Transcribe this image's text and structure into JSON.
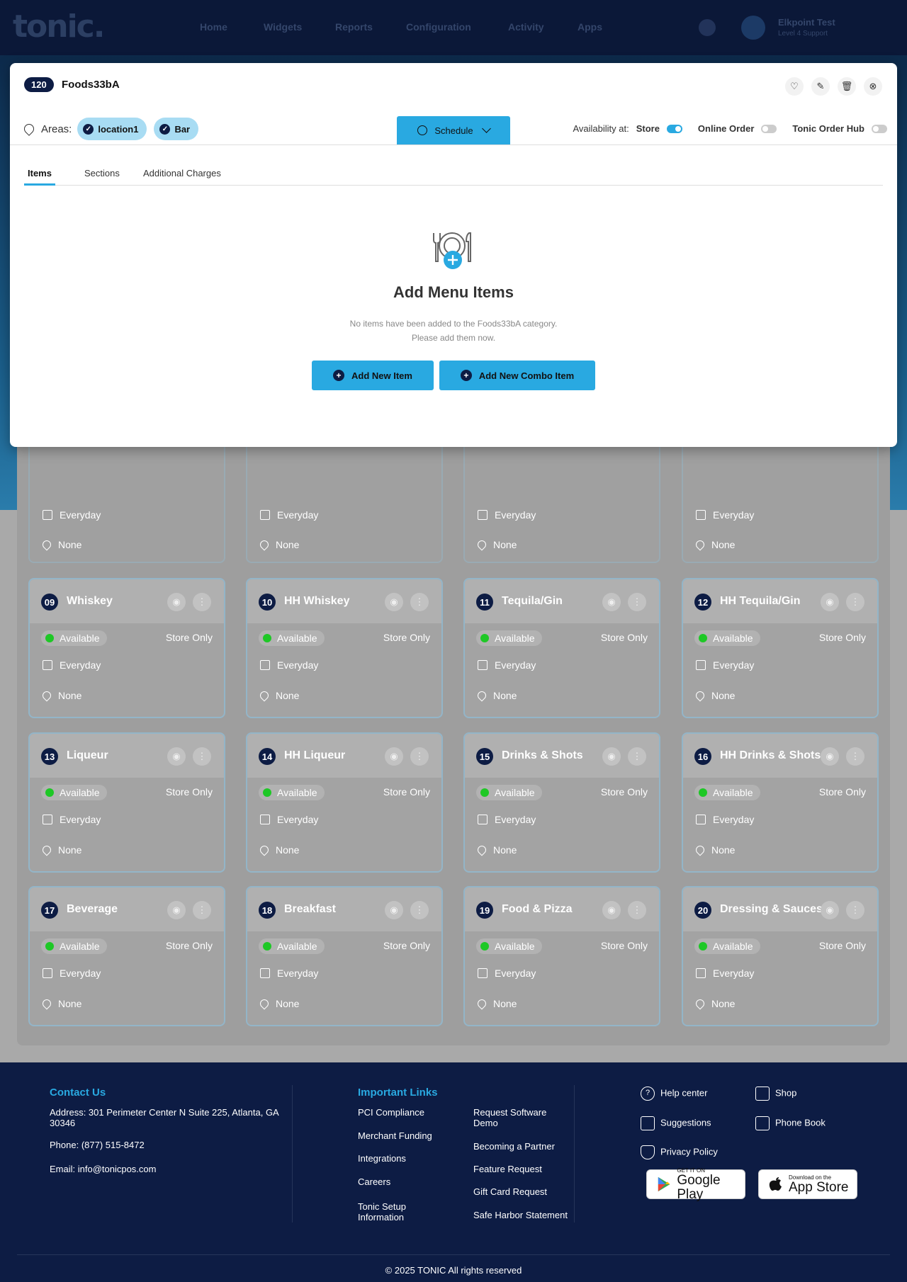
{
  "app": {
    "logo": "tonic.",
    "nav": [
      "Home",
      "Widgets",
      "Reports",
      "Configuration",
      "Activity",
      "Apps"
    ],
    "user_name": "Elkpoint Test",
    "user_sub": "Level 4 Support"
  },
  "modal": {
    "badge": "120",
    "title": "Foods33bA",
    "areas_label": "Areas:",
    "areas": [
      "location1",
      "Bar"
    ],
    "schedule_label": "Schedule",
    "availability_label": "Availability at:",
    "availability": [
      {
        "label": "Store",
        "on": true
      },
      {
        "label": "Online Order",
        "on": false
      },
      {
        "label": "Tonic Order Hub",
        "on": false
      }
    ],
    "tabs": [
      "Items",
      "Sections",
      "Additional Charges"
    ],
    "empty_title": "Add Menu Items",
    "empty_line1": "No items have been added to the Foods33bA category.",
    "empty_line2": "Please add them now.",
    "add_item": "Add New Item",
    "add_combo": "Add New Combo Item"
  },
  "partial_cards": [
    {
      "schedule": "Everyday",
      "location": "None"
    },
    {
      "schedule": "Everyday",
      "location": "None"
    },
    {
      "schedule": "Everyday",
      "location": "None"
    },
    {
      "schedule": "Everyday",
      "location": "None"
    }
  ],
  "cards": [
    {
      "num": "09",
      "name": "Whiskey",
      "status": "Available",
      "channel": "Store Only",
      "schedule": "Everyday",
      "location": "None"
    },
    {
      "num": "10",
      "name": "HH Whiskey",
      "status": "Available",
      "channel": "Store Only",
      "schedule": "Everyday",
      "location": "None"
    },
    {
      "num": "11",
      "name": "Tequila/Gin",
      "status": "Available",
      "channel": "Store Only",
      "schedule": "Everyday",
      "location": "None"
    },
    {
      "num": "12",
      "name": "HH Tequila/Gin",
      "status": "Available",
      "channel": "Store Only",
      "schedule": "Everyday",
      "location": "None"
    },
    {
      "num": "13",
      "name": "Liqueur",
      "status": "Available",
      "channel": "Store Only",
      "schedule": "Everyday",
      "location": "None"
    },
    {
      "num": "14",
      "name": "HH Liqueur",
      "status": "Available",
      "channel": "Store Only",
      "schedule": "Everyday",
      "location": "None"
    },
    {
      "num": "15",
      "name": "Drinks & Shots",
      "status": "Available",
      "channel": "Store Only",
      "schedule": "Everyday",
      "location": "None"
    },
    {
      "num": "16",
      "name": "HH Drinks & Shots",
      "status": "Available",
      "channel": "Store Only",
      "schedule": "Everyday",
      "location": "None"
    },
    {
      "num": "17",
      "name": "Beverage",
      "status": "Available",
      "channel": "Store Only",
      "schedule": "Everyday",
      "location": "None"
    },
    {
      "num": "18",
      "name": "Breakfast",
      "status": "Available",
      "channel": "Store Only",
      "schedule": "Everyday",
      "location": "None"
    },
    {
      "num": "19",
      "name": "Food & Pizza",
      "status": "Available",
      "channel": "Store Only",
      "schedule": "Everyday",
      "location": "None"
    },
    {
      "num": "20",
      "name": "Dressing & Sauces",
      "status": "Available",
      "channel": "Store Only",
      "schedule": "Everyday",
      "location": "None"
    }
  ],
  "footer": {
    "contact_title": "Contact Us",
    "address": "Address: 301 Perimeter Center N Suite 225, Atlanta, GA 30346",
    "phone": "Phone: (877) 515-8472",
    "email": "Email: info@tonicpos.com",
    "links_title": "Important Links",
    "links_col1": [
      "PCI Compliance",
      "Merchant Funding",
      "Integrations",
      "Careers",
      "Tonic Setup Information"
    ],
    "links_col2": [
      "Request Software Demo",
      "Becoming a Partner",
      "Feature Request",
      "Gift Card Request",
      "Safe Harbor Statement"
    ],
    "help_center": "Help center",
    "shop": "Shop",
    "suggestions": "Suggestions",
    "phone_book": "Phone Book",
    "privacy": "Privacy Policy",
    "google_small": "GET IT ON",
    "google_large": "Google Play",
    "apple_small": "Download on the",
    "apple_large": "App Store",
    "copyright": "© 2025 TONIC All rights reserved"
  },
  "colors": {
    "accent": "#29a9e1",
    "navy": "#0d1c44",
    "available": "#1ec826"
  }
}
